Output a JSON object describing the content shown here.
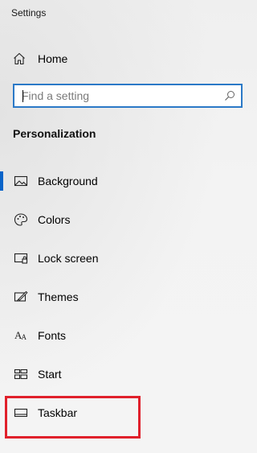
{
  "window": {
    "title": "Settings"
  },
  "home": {
    "label": "Home",
    "icon": "home-icon"
  },
  "search": {
    "placeholder": "Find a setting",
    "value": "",
    "icon": "search-icon"
  },
  "section": {
    "title": "Personalization"
  },
  "nav": {
    "items": [
      {
        "label": "Background",
        "icon": "picture-icon",
        "selected": true
      },
      {
        "label": "Colors",
        "icon": "palette-icon",
        "selected": false
      },
      {
        "label": "Lock screen",
        "icon": "lock-screen-icon",
        "selected": false
      },
      {
        "label": "Themes",
        "icon": "themes-brush-icon",
        "selected": false
      },
      {
        "label": "Fonts",
        "icon": "fonts-icon",
        "selected": false
      },
      {
        "label": "Start",
        "icon": "start-tiles-icon",
        "selected": false
      },
      {
        "label": "Taskbar",
        "icon": "taskbar-icon",
        "selected": false
      }
    ]
  },
  "colors": {
    "accent": "#0a64c9",
    "search_border": "#2b79c7",
    "annotation_box": "#e0202b"
  }
}
